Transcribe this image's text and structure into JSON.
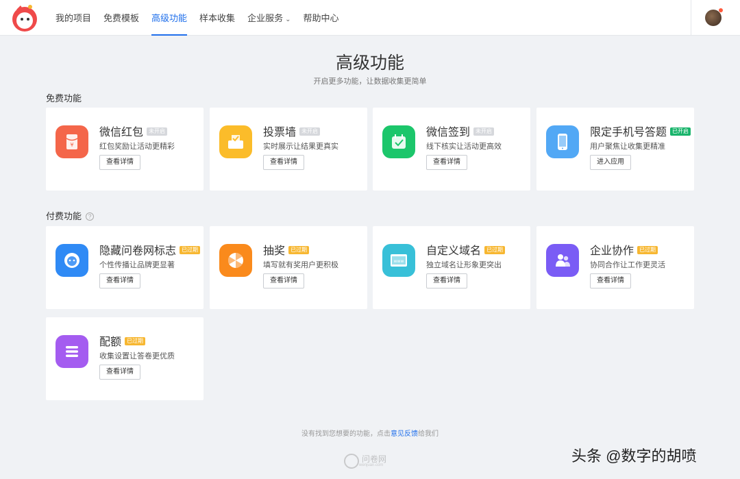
{
  "nav": {
    "items": [
      {
        "label": "我的项目"
      },
      {
        "label": "免费模板"
      },
      {
        "label": "高级功能"
      },
      {
        "label": "样本收集"
      },
      {
        "label": "企业服务"
      },
      {
        "label": "帮助中心"
      }
    ],
    "active_item": "高级功能"
  },
  "page": {
    "title": "高级功能",
    "subtitle": "开启更多功能，让数据收集更简单"
  },
  "sections": {
    "free_title": "免费功能",
    "paid_title": "付费功能",
    "paid_help_icon": "?"
  },
  "free_cards": [
    {
      "name": "微信红包",
      "badge": "未开启",
      "desc": "红包奖励让活动更精彩",
      "button": "查看详情",
      "icon": "red-envelope-icon",
      "color": "#f4664a"
    },
    {
      "name": "投票墙",
      "badge": "未开启",
      "desc": "实时展示让结果更真实",
      "button": "查看详情",
      "icon": "vote-box-icon",
      "color": "#fbbc2a"
    },
    {
      "name": "微信签到",
      "badge": "未开启",
      "desc": "线下核实让活动更高效",
      "button": "查看详情",
      "icon": "calendar-check-icon",
      "color": "#1cc66b"
    },
    {
      "name": "限定手机号答题",
      "badge": "已开启",
      "desc": "用户聚焦让收集更精准",
      "button": "进入应用",
      "icon": "phone-icon",
      "color": "#52a8f5"
    }
  ],
  "paid_cards": [
    {
      "name": "隐藏问卷网标志",
      "badge": "已过期",
      "desc": "个性传播让品牌更显著",
      "button": "查看详情",
      "icon": "brand-logo-icon",
      "color": "#2f8af5"
    },
    {
      "name": "抽奖",
      "badge": "已过期",
      "desc": "填写就有奖用户更积极",
      "button": "查看详情",
      "icon": "lottery-wheel-icon",
      "color": "#fa8a1c"
    },
    {
      "name": "自定义域名",
      "badge": "已过期",
      "desc": "独立域名让形象更突出",
      "button": "查看详情",
      "icon": "www-domain-icon",
      "color": "#38c0d8"
    },
    {
      "name": "企业协作",
      "badge": "已过期",
      "desc": "协同合作让工作更灵活",
      "button": "查看详情",
      "icon": "team-collab-icon",
      "color": "#7a5cf5"
    },
    {
      "name": "配额",
      "badge": "已过期",
      "desc": "收集设置让答卷更优质",
      "button": "查看详情",
      "icon": "quota-list-icon",
      "color": "#a45cf0"
    }
  ],
  "footer": {
    "text_before": "没有找到您想要的功能，点击",
    "link": "意见反馈",
    "text_after": "给我们",
    "logo_text": "问卷网",
    "logo_sub": "wenjuan.com"
  },
  "watermark": "头条 @数字的胡喷"
}
